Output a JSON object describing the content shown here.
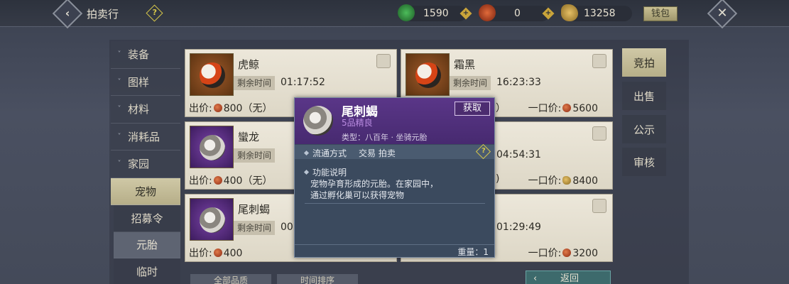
{
  "header": {
    "title": "拍卖行",
    "currencies": [
      {
        "name": "jade-icon",
        "value": "1590",
        "color": "#3a9a4a"
      },
      {
        "name": "red-coin-icon",
        "value": "0",
        "color": "#c0442a"
      },
      {
        "name": "gold-coin-icon",
        "value": "13258",
        "color": "#c9a43a"
      }
    ],
    "money_bag_label": "钱包"
  },
  "sidebar": {
    "items": [
      {
        "label": "装备"
      },
      {
        "label": "图样"
      },
      {
        "label": "材料"
      },
      {
        "label": "消耗品"
      },
      {
        "label": "家园"
      },
      {
        "label": "宠物"
      }
    ],
    "subitems": [
      {
        "label": "招募令"
      },
      {
        "label": "元胎"
      },
      {
        "label": "临时"
      }
    ]
  },
  "cards": [
    {
      "name": "虎鲸",
      "time_label": "剩余时间",
      "time": "01:17:52",
      "price_label": "出价:",
      "price": "800（无）",
      "buyout_label": "",
      "buyout": ""
    },
    {
      "name": "霜黑",
      "time_label": "剩余时间",
      "time": "16:23:33",
      "price_label": "",
      "price": "）",
      "buyout_label": "一口价:",
      "buyout": "5600"
    },
    {
      "name": "蠻龙",
      "time_label": "剩余时间",
      "time": "04:54:31",
      "price_label": "出价:",
      "price": "400（无）",
      "buyout_label": "一口价:",
      "buyout": "8400"
    },
    {
      "name": "",
      "time_label": "",
      "time": "",
      "price_label": "",
      "price": ")",
      "buyout_label": "",
      "buyout": ""
    },
    {
      "name": "尾刺蝎",
      "time_label": "剩余时间",
      "time": "00",
      "price_label": "出价:",
      "price": "400",
      "buyout_label": "",
      "buyout": ""
    },
    {
      "name": "",
      "time_label": "",
      "time": "01:29:49",
      "price_label": "",
      "price": "",
      "buyout_label": "一口价:",
      "buyout": "3200"
    }
  ],
  "right_tabs": [
    {
      "label": "竞拍"
    },
    {
      "label": "出售"
    },
    {
      "label": "公示"
    },
    {
      "label": "审核"
    }
  ],
  "bottom": {
    "quality_filter": "全部品质",
    "time_sort": "时间排序",
    "return_label": "返回"
  },
  "popup": {
    "name": "尾刺蝎",
    "grade": "5品精良",
    "type": "类型：八百年 · 坐骑元胎",
    "obtain_label": "获取",
    "circulation_label": "流通方式",
    "circulation_value": "交易 拍卖",
    "desc_title": "功能说明",
    "desc_line1": "宠物孕育形成的元胎。在家园中，",
    "desc_line2": "通过孵化巢可以获得宠物",
    "weight": "重量：1"
  }
}
